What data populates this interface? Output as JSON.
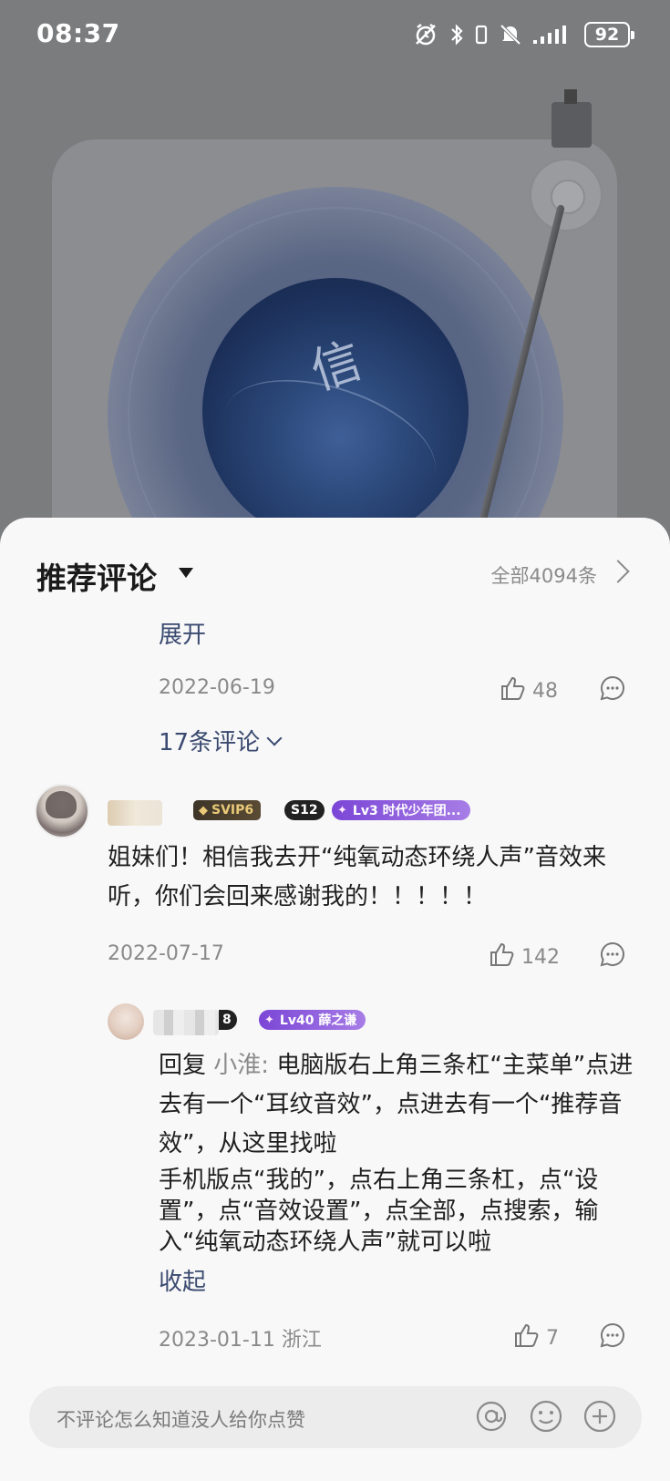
{
  "status_bar": {
    "time": "08:37",
    "battery": "92",
    "icons": [
      "alarm-icon",
      "bluetooth-icon",
      "vibrate-icon",
      "mute-bell-icon",
      "signal-icon",
      "battery-icon"
    ]
  },
  "player": {
    "album_art_text": "信"
  },
  "comments_sheet": {
    "title": "推荐评论",
    "all_count": "全部4094条",
    "top_comment": {
      "expand": "展开",
      "date": "2022-06-19",
      "likes": "48",
      "replies_link": "17条评论"
    },
    "comment": {
      "badges": [
        "SVIP6",
        "S12",
        "Lv3 时代少年团..."
      ],
      "text": "姐妹们！相信我去开“纯氧动态环绕人声”音效来听，你们会回来感谢我的！！！！！",
      "date": "2022-07-17",
      "likes": "142"
    },
    "reply": {
      "badges": [
        "8",
        "Lv40 薛之谦"
      ],
      "prefix": "回复",
      "reply_to": "小淮:",
      "text_line1": "电脑版右上角三条杠“主菜单”点进去有一个“耳纹音效”，点进去有一个“推荐音效”，从这里找啦",
      "text_line2": "手机版点“我的”，点右上角三条杠，点“设置”，点“音效设置”，点全部，点搜索，输入“纯氧动态环绕人声”就可以啦",
      "collapse": "收起",
      "date": "2023-01-11 浙江",
      "likes": "7"
    }
  },
  "input_bar": {
    "placeholder": "不评论怎么知道没人给你点赞"
  },
  "colors": {
    "link": "#3a4a70",
    "meta": "#8a8a8a",
    "lv_badge": "#8b5cdc",
    "svip_gold": "#e9c978"
  }
}
